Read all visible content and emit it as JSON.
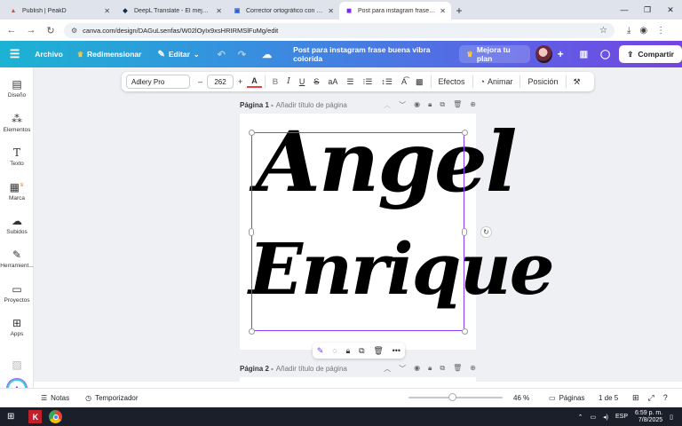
{
  "browser": {
    "tabs": [
      {
        "icon": "peakd-icon",
        "title": "Publish | PeakD",
        "active": false
      },
      {
        "icon": "deepl-icon",
        "title": "DeepL Translate - El mejor tradu",
        "active": false
      },
      {
        "icon": "corrector-icon",
        "title": "Corrector ortográfico con IA gr",
        "active": false
      },
      {
        "icon": "canva-icon",
        "title": "Post para instagram frase buena",
        "active": true
      }
    ],
    "url": "canva.com/design/DAGuLsenfas/W02lOyIx9xsHRIRMSlFuMg/edit"
  },
  "canva_header": {
    "file_label": "Archivo",
    "resize_label": "Redimensionar",
    "edit_label": "Editar",
    "doc_title": "Post para instagram frase buena vibra colorida",
    "upgrade_label": "Mejora tu plan",
    "share_label": "Compartir"
  },
  "sidebar": {
    "items": [
      {
        "label": "Diseño",
        "icon": "layout-icon"
      },
      {
        "label": "Elementos",
        "icon": "shapes-icon"
      },
      {
        "label": "Texto",
        "icon": "text-icon"
      },
      {
        "label": "Marca",
        "icon": "brand-icon"
      },
      {
        "label": "Subidos",
        "icon": "upload-icon"
      },
      {
        "label": "Herramient...",
        "icon": "tools-icon"
      },
      {
        "label": "Proyectos",
        "icon": "folder-icon"
      },
      {
        "label": "Apps",
        "icon": "apps-icon"
      }
    ]
  },
  "text_toolbar": {
    "font_name": "Adlery Pro",
    "font_size": "262",
    "effects_label": "Efectos",
    "animate_label": "Animar",
    "position_label": "Posición"
  },
  "pages": [
    {
      "label": "Página 1 -",
      "placeholder": "Añadir título de página"
    },
    {
      "label": "Página 2 -",
      "placeholder": "Añadir título de página"
    }
  ],
  "design": {
    "line1": "Angel",
    "line2": "Enrique"
  },
  "footer": {
    "notes_label": "Notas",
    "timer_label": "Temporizador",
    "zoom": "46 %",
    "zoom_fraction": 0.46,
    "pages_label": "Páginas",
    "page_count": "1 de 5"
  },
  "taskbar": {
    "lang": "ESP",
    "time": "6:59 p. m.",
    "date": "7/8/2025"
  }
}
